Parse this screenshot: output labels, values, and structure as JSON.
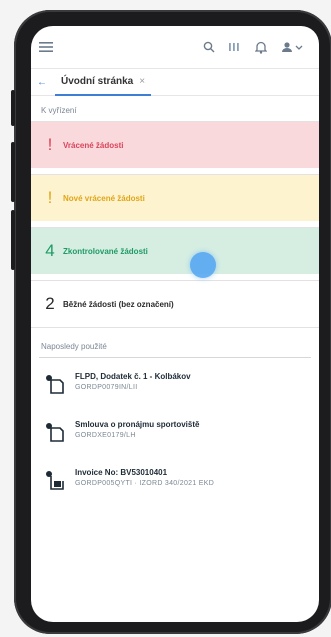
{
  "header": {
    "icons": [
      "menu-icon",
      "search-icon",
      "grid-icon",
      "bell-icon",
      "user-icon"
    ]
  },
  "tabs": {
    "back_glyph": "←",
    "active_label": "Úvodní stránka",
    "close_glyph": "×"
  },
  "main": {
    "section_label": "K vyřízení",
    "cards": [
      {
        "num": "!",
        "label": "Vrácené žádosti",
        "color": "#d9455a"
      },
      {
        "num": "!",
        "label": "Nové vrácené žádosti",
        "color": "#e0a619"
      },
      {
        "num": "4",
        "label": "Zkontrolované žádosti",
        "color": "#1f9a64"
      },
      {
        "num": "2",
        "label": "Běžné žádosti (bez označení)",
        "color": "#2a2a2a"
      }
    ],
    "recent_label": "Naposledy použité",
    "documents": [
      {
        "title": "FLPD, Dodatek č. 1 - Kolbákov",
        "subtitle": "GORDP0079IN/LII"
      },
      {
        "title": "Smlouva o pronájmu sportoviště",
        "subtitle": "GORDXE0179/LH"
      },
      {
        "title": "Invoice No: BV53010401",
        "subtitle": "GORDP005QYTI · IZORD 340/2021 EKD"
      }
    ]
  }
}
